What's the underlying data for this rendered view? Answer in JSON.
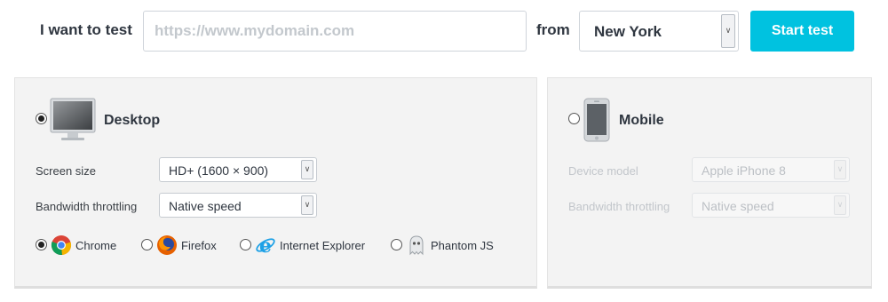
{
  "topbar": {
    "label_test": "I want to test",
    "url_placeholder": "https://www.mydomain.com",
    "label_from": "from",
    "location": "New York",
    "start_label": "Start test",
    "accent_color": "#00c2e0"
  },
  "desktop": {
    "title": "Desktop",
    "selected": true,
    "icon": "desktop-monitor-icon",
    "screen_size_label": "Screen size",
    "screen_size_value": "HD+ (1600 × 900)",
    "bandwidth_label": "Bandwidth throttling",
    "bandwidth_value": "Native speed",
    "browsers": [
      {
        "label": "Chrome",
        "icon": "chrome-icon",
        "selected": true
      },
      {
        "label": "Firefox",
        "icon": "firefox-icon",
        "selected": false
      },
      {
        "label": "Internet Explorer",
        "icon": "internet-explorer-icon",
        "selected": false
      },
      {
        "label": "Phantom JS",
        "icon": "phantomjs-ghost-icon",
        "selected": false
      }
    ]
  },
  "mobile": {
    "title": "Mobile",
    "selected": false,
    "icon": "mobile-phone-icon",
    "device_label": "Device model",
    "device_value": "Apple iPhone 8",
    "bandwidth_label": "Bandwidth throttling",
    "bandwidth_value": "Native speed"
  }
}
